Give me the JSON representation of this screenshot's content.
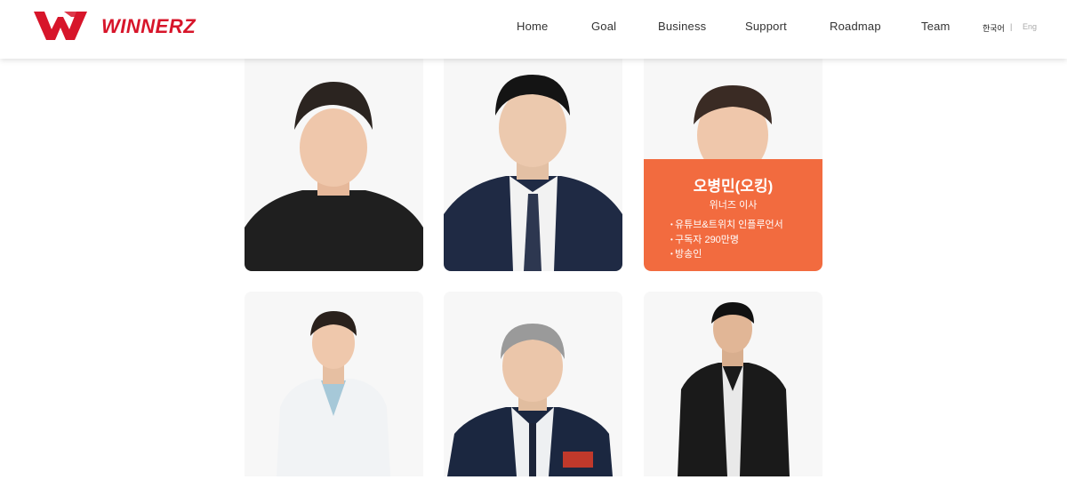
{
  "brand": {
    "logo_text": "WINNERZ",
    "color": "#d7152a"
  },
  "nav": {
    "items": [
      {
        "label": "Home"
      },
      {
        "label": "Goal"
      },
      {
        "label": "Business"
      },
      {
        "label": "Support"
      },
      {
        "label": "Roadmap"
      },
      {
        "label": "Team"
      }
    ],
    "lang_ko": "한국어",
    "lang_sep": "|",
    "lang_en": "Eng"
  },
  "team": {
    "highlight_color": "#f26b3f",
    "featured": {
      "name": "오병민(오킹)",
      "title": "위너즈 이사",
      "bullets": [
        "유튜브&트위치 인플루언서",
        "구독자 290만명",
        "방송인"
      ]
    }
  }
}
